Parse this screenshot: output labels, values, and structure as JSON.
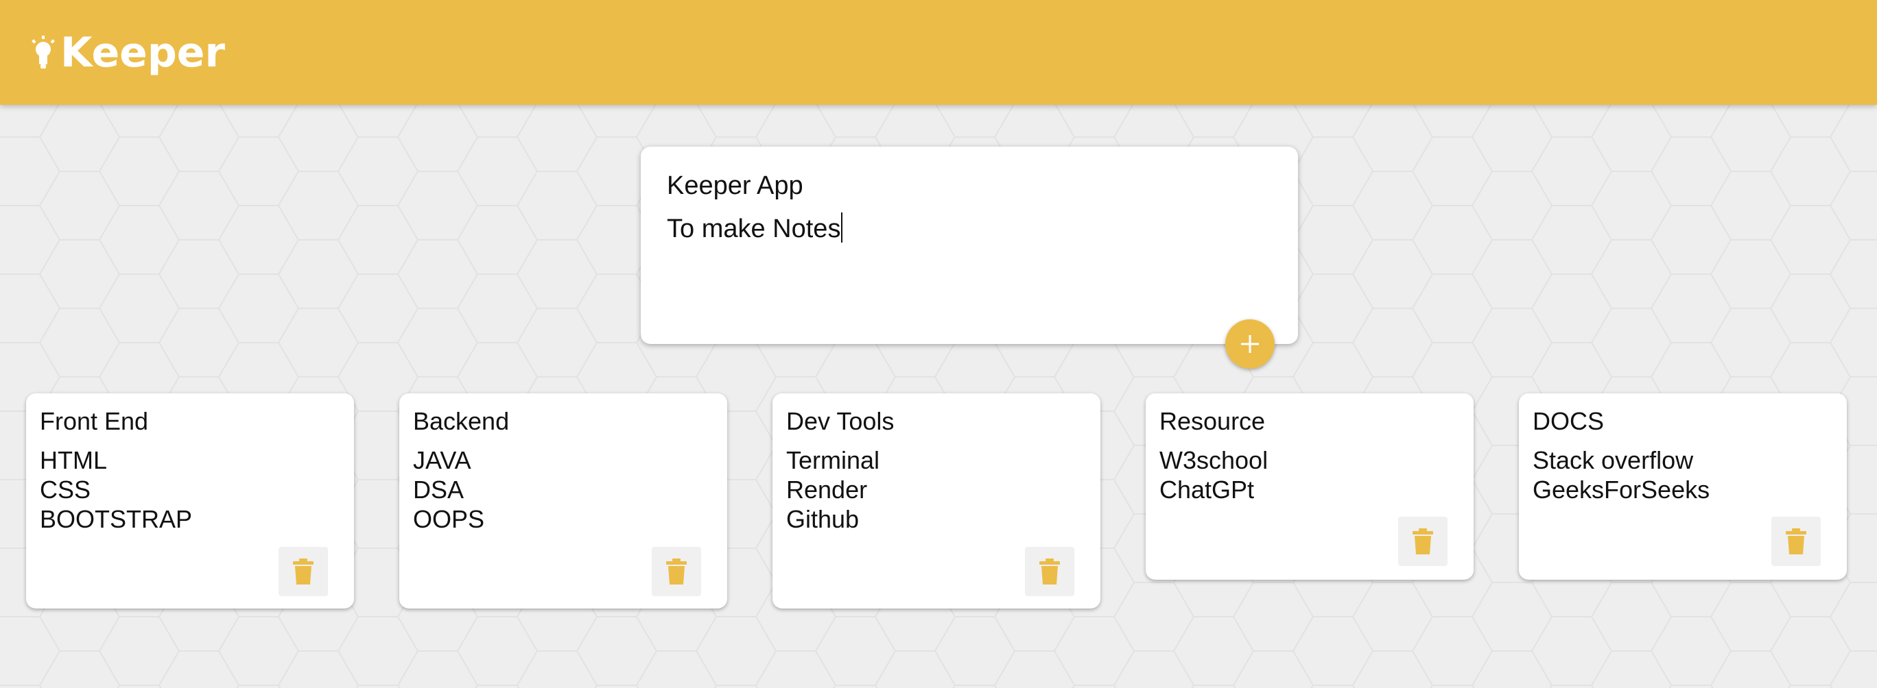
{
  "header": {
    "app_name": "Keeper",
    "logo_icon": "lightbulb-icon"
  },
  "create_note": {
    "title_value": "Keeper App",
    "content_value": "To make Notes",
    "add_button_icon": "plus-icon"
  },
  "notes": [
    {
      "title": "Front End",
      "lines": [
        "HTML",
        "CSS",
        "BOOTSTRAP"
      ],
      "delete_icon": "trash-icon"
    },
    {
      "title": "Backend",
      "lines": [
        "JAVA",
        "DSA",
        "OOPS"
      ],
      "delete_icon": "trash-icon"
    },
    {
      "title": "Dev Tools",
      "lines": [
        "Terminal",
        "Render",
        "Github"
      ],
      "delete_icon": "trash-icon"
    },
    {
      "title": "Resource",
      "lines": [
        "W3school",
        "ChatGPt"
      ],
      "delete_icon": "trash-icon"
    },
    {
      "title": "DOCS",
      "lines": [
        "Stack overflow",
        "GeeksForSeeks"
      ],
      "delete_icon": "trash-icon"
    }
  ],
  "colors": {
    "accent": "#ecbc48",
    "background": "#eeeeee",
    "card": "#ffffff",
    "text": "#111111",
    "delete_button_bg": "#f0f0f0"
  }
}
